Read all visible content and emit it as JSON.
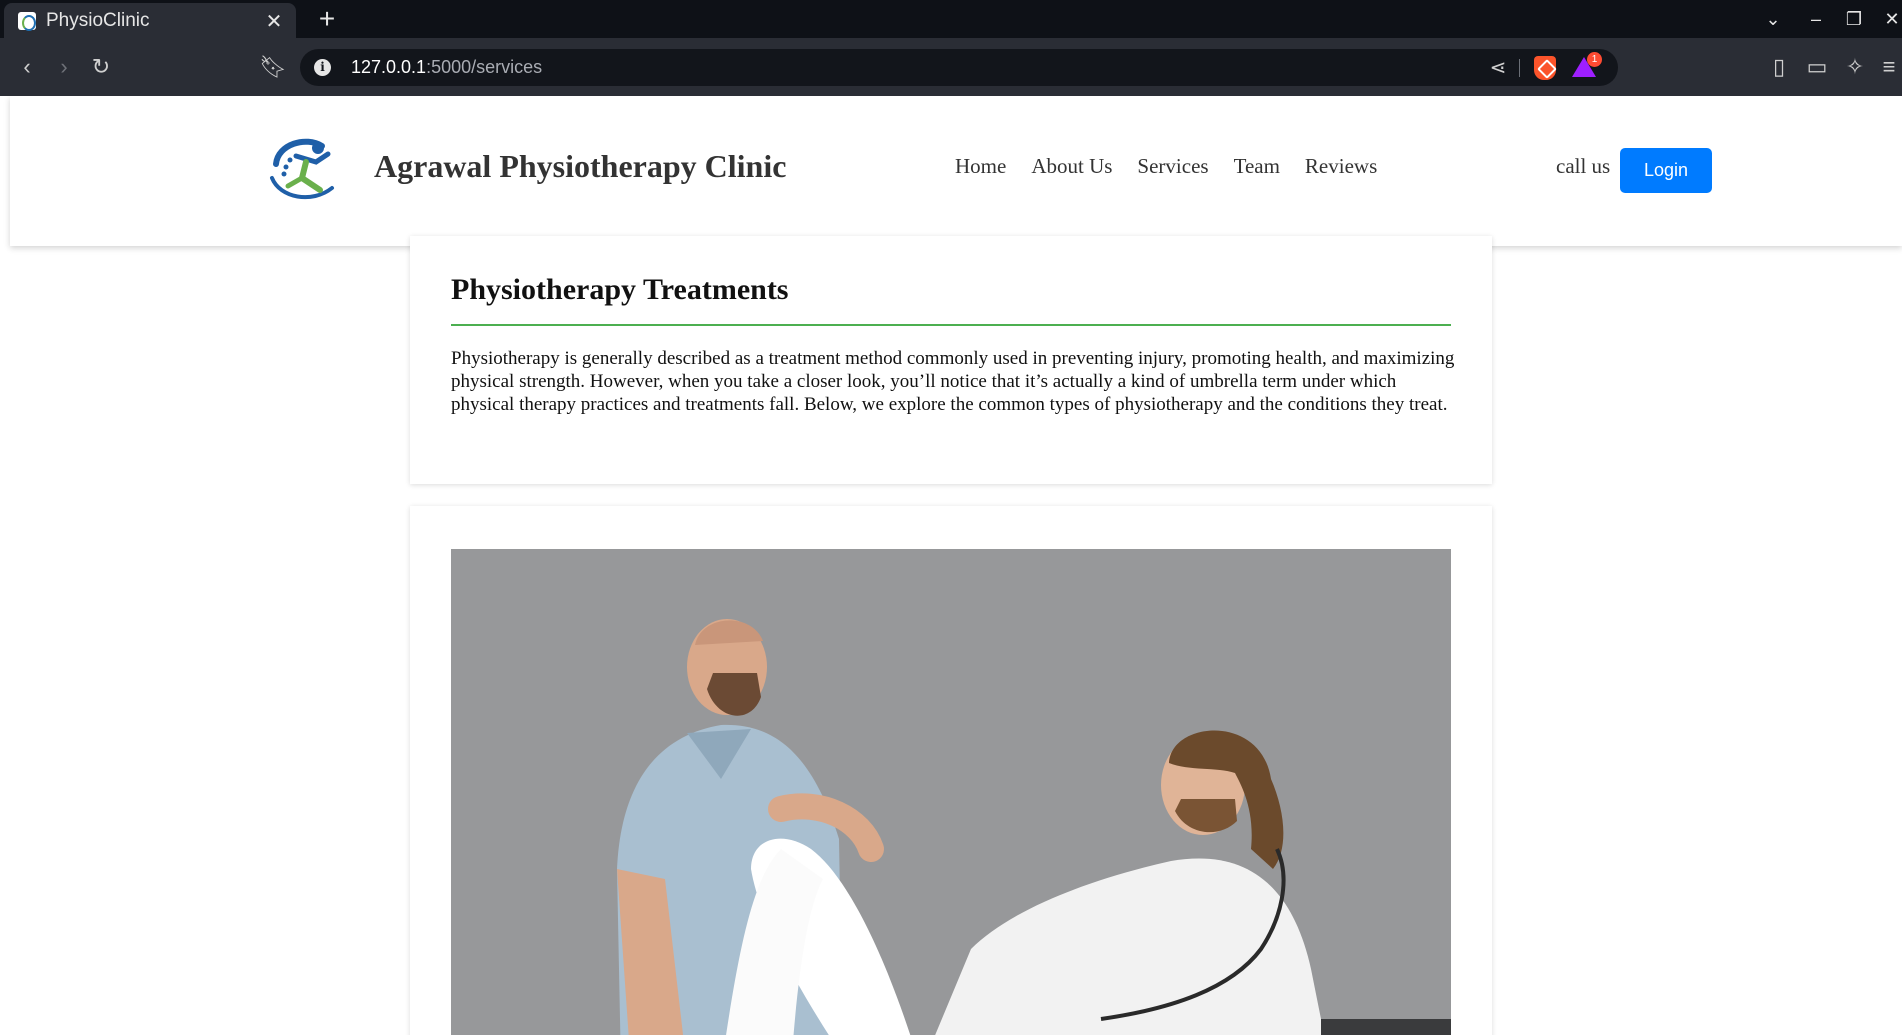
{
  "browser": {
    "tab_title": "PhysioClinic",
    "url_host": "127.0.0.1",
    "url_path": ":5000/services",
    "rewards_badge": "1"
  },
  "site": {
    "name": "Agrawal Physiotherapy Clinic",
    "nav": [
      "Home",
      "About Us",
      "Services",
      "Team",
      "Reviews"
    ],
    "call_label": "call us",
    "login_label": "Login",
    "colors": {
      "accent": "#007bff",
      "rule": "#4caf50"
    }
  },
  "intro": {
    "title": "Physiotherapy Treatments",
    "text": "Physiotherapy is generally described as a treatment method commonly used in preventing injury, promoting health, and maximizing physical strength. However, when you take a closer look, you’ll notice that it’s actually a kind of umbrella term under which physical therapy practices and treatments fall. Below, we explore the common types of physiotherapy and the conditions they treat."
  }
}
